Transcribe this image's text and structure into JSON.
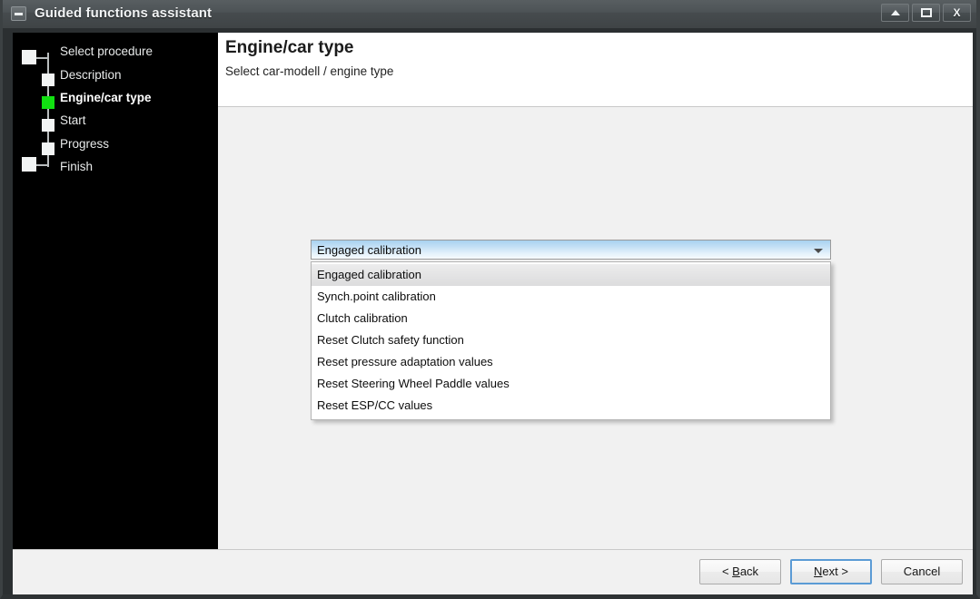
{
  "window": {
    "title": "Guided functions assistant",
    "icon": "window-minus-icon",
    "controls": [
      {
        "name": "minimize-button",
        "glyph": "triangle-up"
      },
      {
        "name": "maximize-button",
        "glyph": "square"
      },
      {
        "name": "close-button",
        "glyph": "X"
      }
    ],
    "accent_color": "#5b9bd5",
    "titlebar_color": "#4a5053"
  },
  "sidebar": {
    "current_step_color": "#11e011",
    "steps": [
      {
        "label": "Select procedure",
        "level": 0,
        "state": "pending"
      },
      {
        "label": "Description",
        "level": 1,
        "state": "pending"
      },
      {
        "label": "Engine/car type",
        "level": 1,
        "state": "current"
      },
      {
        "label": "Start",
        "level": 1,
        "state": "pending"
      },
      {
        "label": "Progress",
        "level": 1,
        "state": "pending"
      },
      {
        "label": "Finish",
        "level": 0,
        "state": "pending"
      }
    ]
  },
  "header": {
    "title": "Engine/car type",
    "subtitle": "Select car-modell / engine type"
  },
  "combobox": {
    "value": "Engaged calibration",
    "expanded": true,
    "arrow_icon": "chevron-down-icon",
    "options": [
      "Engaged calibration",
      "Synch.point calibration",
      "Clutch calibration",
      "Reset Clutch safety function",
      "Reset pressure adaptation values",
      "Reset Steering Wheel Paddle values",
      "Reset ESP/CC values"
    ],
    "selected_index": 0
  },
  "footer": {
    "buttons": [
      {
        "name": "back-button",
        "prefix": "< ",
        "accel": "B",
        "suffix": "ack",
        "focused": false
      },
      {
        "name": "next-button",
        "prefix": "",
        "accel": "N",
        "suffix": "ext >",
        "focused": true
      },
      {
        "name": "cancel-button",
        "prefix": "",
        "accel": "C",
        "suffix": "ancel",
        "focused": false
      }
    ]
  }
}
